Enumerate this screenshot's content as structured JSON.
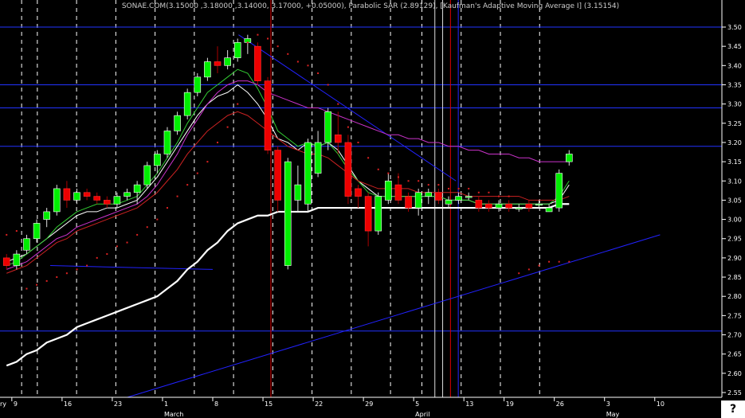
{
  "chart_data": {
    "type": "candlestick",
    "title": "SONAE.COM(3.15000 ,3.18000 ,3.14000, 3.17000, +0.05000), Parabolic SAR (2.89129), [Kaufman's Adaptive Moving Average I] (3.15154)",
    "ylim": [
      2.53,
      3.52
    ],
    "yticks": [
      "3.50",
      "3.45",
      "3.40",
      "3.35",
      "3.30",
      "3.25",
      "3.20",
      "3.15",
      "3.10",
      "3.05",
      "3.00",
      "2.95",
      "2.90",
      "2.85",
      "2.80",
      "2.75",
      "2.70",
      "2.65",
      "2.60",
      "2.55"
    ],
    "xticks": [
      {
        "label": "ry",
        "i": -1
      },
      {
        "label": "9",
        "i": 1
      },
      {
        "label": "16",
        "i": 6
      },
      {
        "label": "23",
        "i": 11
      },
      {
        "label": "1",
        "i": 16
      },
      {
        "label": "March",
        "i": 16
      },
      {
        "label": "8",
        "i": 21
      },
      {
        "label": "15",
        "i": 26
      },
      {
        "label": "22",
        "i": 31
      },
      {
        "label": "29",
        "i": 36
      },
      {
        "label": "5",
        "i": 41
      },
      {
        "label": "April",
        "i": 41
      },
      {
        "label": "13",
        "i": 46
      },
      {
        "label": "19",
        "i": 50
      },
      {
        "label": "26",
        "i": 55
      },
      {
        "label": "3",
        "i": 60
      },
      {
        "label": "May",
        "i": 60
      },
      {
        "label": "10",
        "i": 65
      }
    ],
    "series": [
      {
        "type": "ohlc",
        "values": [
          [
            2.9,
            2.91,
            2.87,
            2.88
          ],
          [
            2.88,
            2.92,
            2.87,
            2.91
          ],
          [
            2.92,
            2.96,
            2.91,
            2.95
          ],
          [
            2.95,
            3.0,
            2.94,
            2.99
          ],
          [
            3.0,
            3.03,
            2.98,
            3.02
          ],
          [
            3.02,
            3.09,
            3.01,
            3.08
          ],
          [
            3.08,
            3.1,
            3.03,
            3.05
          ],
          [
            3.05,
            3.08,
            3.04,
            3.07
          ],
          [
            3.07,
            3.08,
            3.05,
            3.06
          ],
          [
            3.06,
            3.07,
            3.04,
            3.05
          ],
          [
            3.05,
            3.06,
            3.03,
            3.04
          ],
          [
            3.04,
            3.07,
            3.03,
            3.06
          ],
          [
            3.06,
            3.08,
            3.05,
            3.07
          ],
          [
            3.07,
            3.1,
            3.04,
            3.09
          ],
          [
            3.09,
            3.15,
            3.08,
            3.14
          ],
          [
            3.14,
            3.18,
            3.12,
            3.17
          ],
          [
            3.17,
            3.24,
            3.16,
            3.23
          ],
          [
            3.23,
            3.28,
            3.22,
            3.27
          ],
          [
            3.27,
            3.34,
            3.26,
            3.33
          ],
          [
            3.33,
            3.38,
            3.32,
            3.37
          ],
          [
            3.37,
            3.42,
            3.36,
            3.41
          ],
          [
            3.41,
            3.45,
            3.38,
            3.4
          ],
          [
            3.4,
            3.44,
            3.39,
            3.42
          ],
          [
            3.42,
            3.47,
            3.41,
            3.46
          ],
          [
            3.46,
            3.48,
            3.43,
            3.47
          ],
          [
            3.45,
            3.46,
            3.35,
            3.36
          ],
          [
            3.36,
            3.37,
            3.17,
            3.18
          ],
          [
            3.18,
            3.19,
            3.02,
            3.05
          ],
          [
            2.88,
            3.16,
            2.87,
            3.15
          ],
          [
            3.05,
            3.14,
            3.02,
            3.09
          ],
          [
            3.04,
            3.21,
            3.02,
            3.2
          ],
          [
            3.12,
            3.23,
            3.11,
            3.2
          ],
          [
            3.2,
            3.29,
            3.18,
            3.28
          ],
          [
            3.22,
            3.28,
            3.17,
            3.2
          ],
          [
            3.2,
            3.22,
            3.04,
            3.06
          ],
          [
            3.08,
            3.09,
            3.03,
            3.06
          ],
          [
            3.06,
            3.07,
            2.93,
            2.97
          ],
          [
            2.97,
            3.07,
            2.96,
            3.06
          ],
          [
            3.05,
            3.12,
            3.04,
            3.1
          ],
          [
            3.09,
            3.12,
            3.04,
            3.05
          ],
          [
            3.06,
            3.07,
            3.02,
            3.03
          ],
          [
            3.03,
            3.08,
            3.01,
            3.07
          ],
          [
            3.06,
            3.08,
            3.04,
            3.07
          ],
          [
            3.07,
            3.08,
            3.04,
            3.05
          ],
          [
            3.04,
            3.06,
            3.03,
            3.05
          ],
          [
            3.05,
            3.07,
            3.04,
            3.06
          ],
          [
            3.06,
            3.07,
            3.05,
            3.06
          ],
          [
            3.05,
            3.06,
            3.02,
            3.03
          ],
          [
            3.04,
            3.05,
            3.02,
            3.03
          ],
          [
            3.03,
            3.05,
            3.02,
            3.04
          ],
          [
            3.04,
            3.05,
            3.02,
            3.03
          ],
          [
            3.03,
            3.04,
            3.02,
            3.03
          ],
          [
            3.04,
            3.05,
            3.02,
            3.03
          ],
          [
            3.04,
            3.05,
            3.03,
            3.04
          ],
          [
            3.02,
            3.04,
            3.02,
            3.03
          ],
          [
            3.03,
            3.13,
            3.02,
            3.12
          ],
          [
            3.15,
            3.18,
            3.14,
            3.17
          ]
        ]
      },
      {
        "type": "line",
        "color": "#ffffff",
        "values": [
          2.62,
          2.63,
          2.65,
          2.66,
          2.68,
          2.69,
          2.7,
          2.72,
          2.73,
          2.74,
          2.75,
          2.76,
          2.77,
          2.78,
          2.79,
          2.8,
          2.82,
          2.84,
          2.87,
          2.89,
          2.92,
          2.94,
          2.97,
          2.99,
          3.0,
          3.01,
          3.01,
          3.02,
          3.02,
          3.02,
          3.02,
          3.03,
          3.03,
          3.03,
          3.03,
          3.03,
          3.03,
          3.03,
          3.03,
          3.03,
          3.03,
          3.03,
          3.03,
          3.03,
          3.03,
          3.03,
          3.03,
          3.03,
          3.03,
          3.03,
          3.03,
          3.03,
          3.03,
          3.03,
          3.03,
          3.04,
          3.04
        ]
      },
      {
        "type": "line",
        "color": "#ffffff",
        "values": [
          2.89,
          2.9,
          2.91,
          2.93,
          2.95,
          2.97,
          2.99,
          3.01,
          3.02,
          3.02,
          3.03,
          3.03,
          3.04,
          3.05,
          3.08,
          3.11,
          3.15,
          3.19,
          3.23,
          3.27,
          3.3,
          3.32,
          3.33,
          3.35,
          3.33,
          3.3,
          3.26,
          3.21,
          3.2,
          3.18,
          3.2,
          3.19,
          3.2,
          3.18,
          3.14,
          3.1,
          3.08,
          3.06,
          3.06,
          3.06,
          3.06,
          3.06,
          3.06,
          3.06,
          3.05,
          3.05,
          3.05,
          3.04,
          3.04,
          3.04,
          3.04,
          3.04,
          3.04,
          3.04,
          3.04,
          3.05,
          3.09
        ]
      },
      {
        "type": "line",
        "color": "#33cc33",
        "values": [
          2.88,
          2.89,
          2.91,
          2.93,
          2.95,
          2.98,
          3.0,
          3.02,
          3.03,
          3.04,
          3.04,
          3.04,
          3.05,
          3.06,
          3.09,
          3.12,
          3.16,
          3.2,
          3.25,
          3.29,
          3.33,
          3.35,
          3.37,
          3.39,
          3.38,
          3.34,
          3.29,
          3.23,
          3.21,
          3.19,
          3.2,
          3.19,
          3.2,
          3.17,
          3.13,
          3.1,
          3.07,
          3.06,
          3.06,
          3.06,
          3.06,
          3.06,
          3.06,
          3.06,
          3.05,
          3.05,
          3.05,
          3.04,
          3.04,
          3.04,
          3.04,
          3.04,
          3.04,
          3.04,
          3.04,
          3.06,
          3.1
        ]
      },
      {
        "type": "line",
        "color": "#cc2222",
        "values": [
          2.86,
          2.87,
          2.88,
          2.9,
          2.92,
          2.94,
          2.95,
          2.97,
          2.98,
          2.99,
          3.0,
          3.01,
          3.02,
          3.03,
          3.05,
          3.07,
          3.1,
          3.13,
          3.17,
          3.2,
          3.23,
          3.25,
          3.27,
          3.28,
          3.27,
          3.25,
          3.23,
          3.21,
          3.19,
          3.18,
          3.17,
          3.17,
          3.16,
          3.14,
          3.12,
          3.1,
          3.09,
          3.08,
          3.08,
          3.08,
          3.08,
          3.07,
          3.07,
          3.07,
          3.07,
          3.07,
          3.06,
          3.06,
          3.06,
          3.06,
          3.06,
          3.06,
          3.05,
          3.05,
          3.05,
          3.05,
          3.06
        ]
      },
      {
        "type": "line",
        "color": "#cc33cc",
        "values": [
          2.87,
          2.88,
          2.89,
          2.91,
          2.93,
          2.95,
          2.96,
          2.98,
          2.99,
          3.0,
          3.01,
          3.02,
          3.03,
          3.04,
          3.06,
          3.09,
          3.13,
          3.17,
          3.22,
          3.26,
          3.3,
          3.33,
          3.35,
          3.36,
          3.36,
          3.35,
          3.33,
          3.32,
          3.31,
          3.3,
          3.29,
          3.29,
          3.28,
          3.27,
          3.26,
          3.25,
          3.24,
          3.23,
          3.22,
          3.22,
          3.21,
          3.21,
          3.2,
          3.2,
          3.19,
          3.19,
          3.18,
          3.18,
          3.17,
          3.17,
          3.17,
          3.16,
          3.16,
          3.15,
          3.15,
          3.15,
          3.15
        ]
      },
      {
        "type": "sar",
        "color": "#dd2222",
        "values": [
          2.96,
          2.97,
          2.82,
          2.83,
          2.84,
          2.85,
          2.86,
          2.87,
          2.88,
          2.9,
          2.91,
          2.93,
          2.94,
          2.96,
          2.98,
          3.0,
          3.03,
          3.06,
          3.09,
          3.12,
          3.15,
          3.2,
          3.24,
          3.3,
          3.46,
          3.48,
          3.47,
          3.45,
          3.43,
          3.41,
          3.4,
          3.38,
          3.35,
          3.3,
          3.24,
          3.2,
          3.16,
          3.13,
          3.12,
          3.11,
          3.1,
          3.1,
          3.09,
          3.09,
          3.08,
          3.08,
          3.08,
          3.07,
          3.07,
          3.06,
          3.06,
          2.86,
          2.87,
          2.88,
          2.89,
          2.89,
          2.89
        ]
      }
    ],
    "hlines": [
      3.5,
      3.35,
      3.29,
      3.19,
      2.71
    ],
    "trendlines": [
      {
        "color": "#2222ff",
        "from": [
          7,
          2.52
        ],
        "to": [
          64,
          2.96
        ]
      },
      {
        "color": "#2222ff",
        "from": [
          24,
          3.48
        ],
        "to": [
          38,
          3.1
        ]
      },
      {
        "color": "#2222ff",
        "from": [
          0,
          2.88
        ],
        "to": [
          7,
          2.87
        ]
      }
    ],
    "vlines": [
      {
        "i": 27,
        "color": "#dd0000"
      },
      {
        "i": 48,
        "color": "#dddddd"
      },
      {
        "i": 49,
        "color": "#dddddd"
      },
      {
        "i": 50,
        "color": "#dd0000"
      },
      {
        "i": 51,
        "color": "#2222ff"
      }
    ],
    "help_label": "?"
  }
}
